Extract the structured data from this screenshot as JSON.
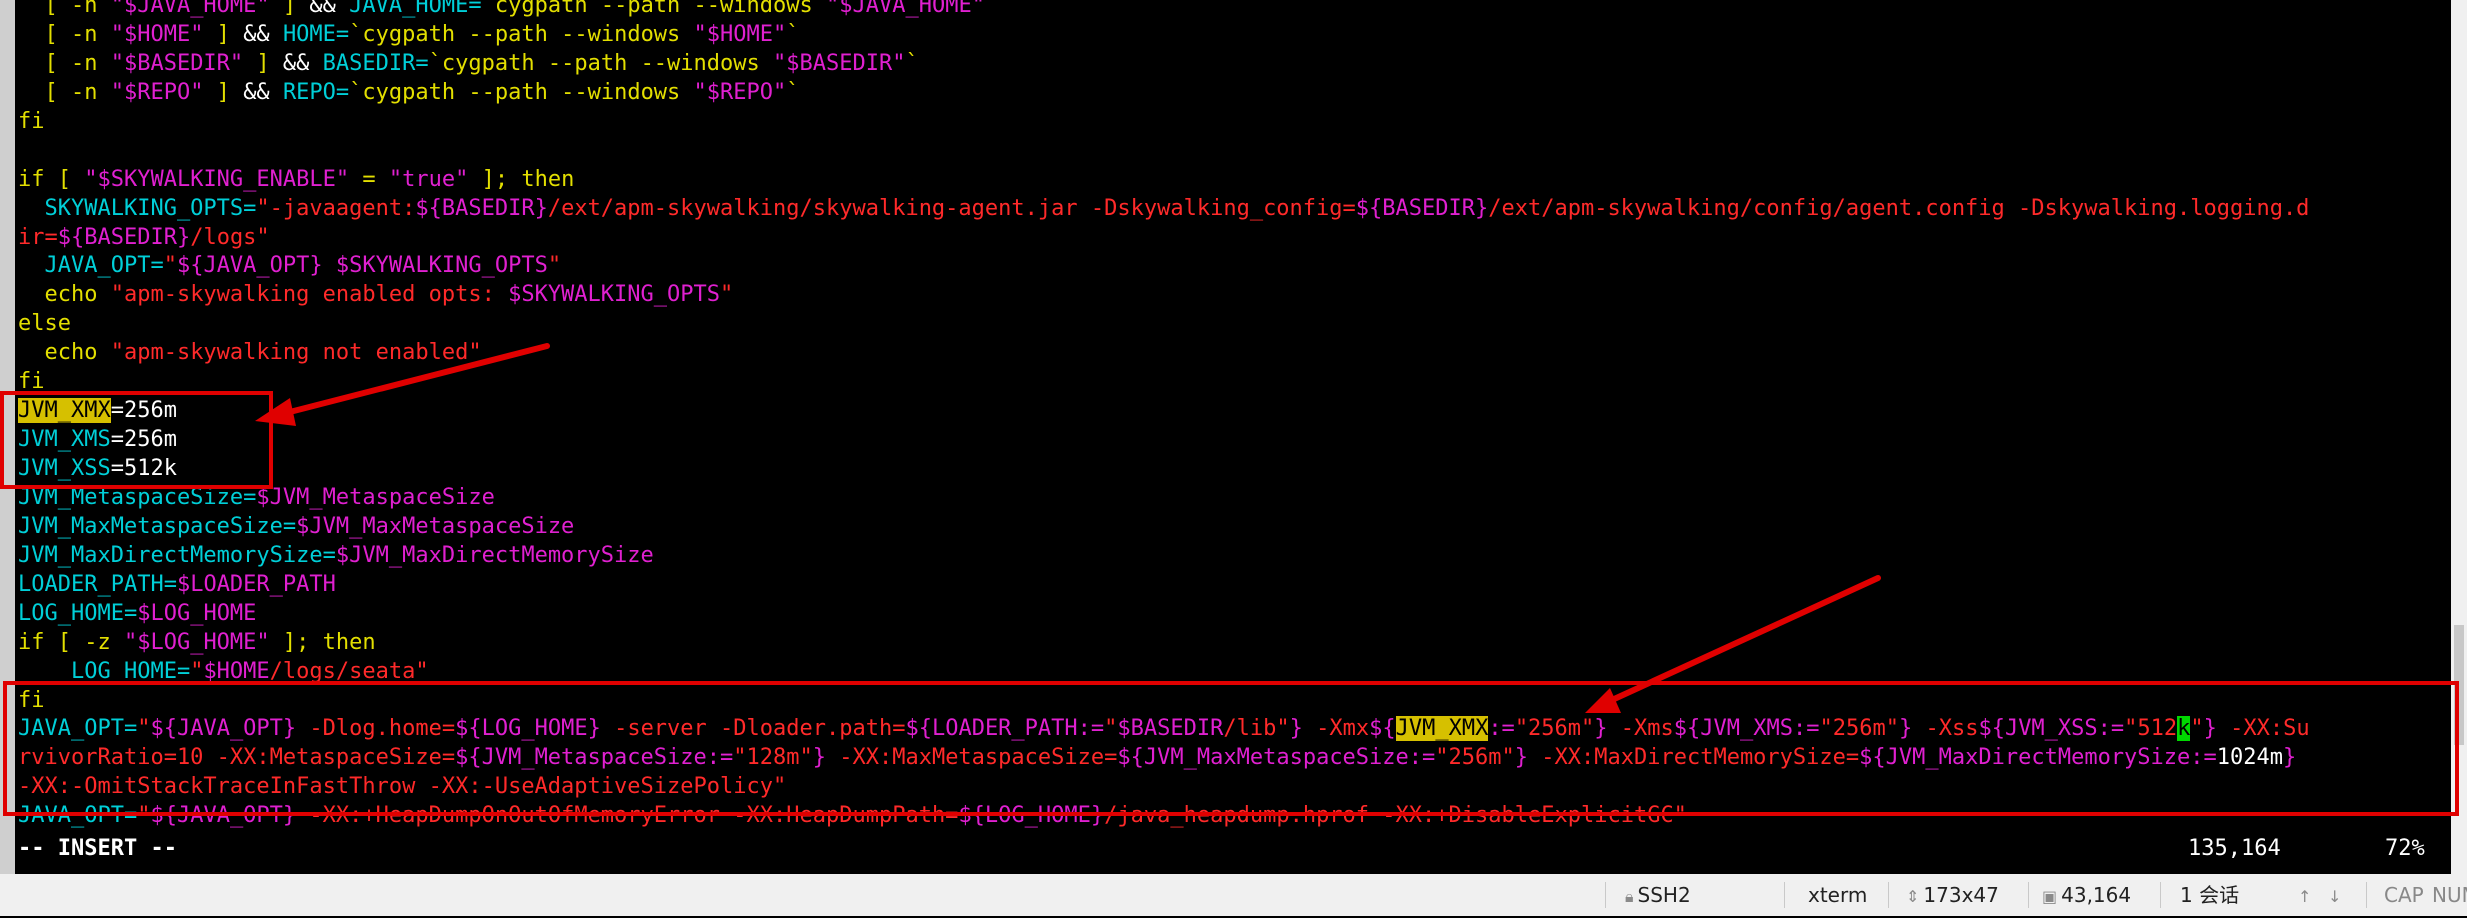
{
  "terminal": {
    "lines": [
      [
        {
          "t": "  [ -n ",
          "c": "y"
        },
        {
          "t": "\"$JAVA_HOME\"",
          "c": "m"
        },
        {
          "t": " ] ",
          "c": "y"
        },
        {
          "t": "&& ",
          "c": "w"
        },
        {
          "t": "JAVA_HOME=",
          "c": "c"
        },
        {
          "t": "`cygpath --path --windows ",
          "c": "y"
        },
        {
          "t": "\"$JAVA_HOME\"",
          "c": "m"
        },
        {
          "t": "`",
          "c": "y"
        }
      ],
      [
        {
          "t": "  [ -n ",
          "c": "y"
        },
        {
          "t": "\"$HOME\"",
          "c": "m"
        },
        {
          "t": " ] ",
          "c": "y"
        },
        {
          "t": "&& ",
          "c": "w"
        },
        {
          "t": "HOME=",
          "c": "c"
        },
        {
          "t": "`cygpath --path --windows ",
          "c": "y"
        },
        {
          "t": "\"$HOME\"",
          "c": "m"
        },
        {
          "t": "`",
          "c": "y"
        }
      ],
      [
        {
          "t": "  [ -n ",
          "c": "y"
        },
        {
          "t": "\"$BASEDIR\"",
          "c": "m"
        },
        {
          "t": " ] ",
          "c": "y"
        },
        {
          "t": "&& ",
          "c": "w"
        },
        {
          "t": "BASEDIR=",
          "c": "c"
        },
        {
          "t": "`cygpath --path --windows ",
          "c": "y"
        },
        {
          "t": "\"$BASEDIR\"",
          "c": "m"
        },
        {
          "t": "`",
          "c": "y"
        }
      ],
      [
        {
          "t": "  [ -n ",
          "c": "y"
        },
        {
          "t": "\"$REPO\"",
          "c": "m"
        },
        {
          "t": " ] ",
          "c": "y"
        },
        {
          "t": "&& ",
          "c": "w"
        },
        {
          "t": "REPO=",
          "c": "c"
        },
        {
          "t": "`cygpath --path --windows ",
          "c": "y"
        },
        {
          "t": "\"$REPO\"",
          "c": "m"
        },
        {
          "t": "`",
          "c": "y"
        }
      ],
      [
        {
          "t": "fi",
          "c": "y"
        }
      ],
      [
        {
          "t": "",
          "c": "w"
        }
      ],
      [
        {
          "t": "if [ ",
          "c": "y"
        },
        {
          "t": "\"$SKYWALKING_ENABLE\"",
          "c": "m"
        },
        {
          "t": " = ",
          "c": "y"
        },
        {
          "t": "\"true\"",
          "c": "m"
        },
        {
          "t": " ]; then",
          "c": "y"
        }
      ],
      [
        {
          "t": "  SKYWALKING_OPTS=",
          "c": "c"
        },
        {
          "t": "\"-javaagent:",
          "c": "r"
        },
        {
          "t": "${BASEDIR}",
          "c": "m"
        },
        {
          "t": "/ext/apm-skywalking/skywalking-agent.jar -Dskywalking_config=",
          "c": "r"
        },
        {
          "t": "${BASEDIR}",
          "c": "m"
        },
        {
          "t": "/ext/apm-skywalking/config/agent.config -Dskywalking.logging.d",
          "c": "r"
        }
      ],
      [
        {
          "t": "ir=",
          "c": "r"
        },
        {
          "t": "${BASEDIR}",
          "c": "m"
        },
        {
          "t": "/logs\"",
          "c": "r"
        }
      ],
      [
        {
          "t": "  JAVA_OPT=",
          "c": "c"
        },
        {
          "t": "\"",
          "c": "r"
        },
        {
          "t": "${JAVA_OPT}",
          "c": "m"
        },
        {
          "t": " ",
          "c": "r"
        },
        {
          "t": "$SKYWALKING_OPTS",
          "c": "m"
        },
        {
          "t": "\"",
          "c": "r"
        }
      ],
      [
        {
          "t": "  echo ",
          "c": "y"
        },
        {
          "t": "\"apm-skywalking enabled opts: ",
          "c": "r"
        },
        {
          "t": "$SKYWALKING_OPTS",
          "c": "m"
        },
        {
          "t": "\"",
          "c": "r"
        }
      ],
      [
        {
          "t": "else",
          "c": "y"
        }
      ],
      [
        {
          "t": "  echo ",
          "c": "y"
        },
        {
          "t": "\"apm-skywalking not enabled\"",
          "c": "r"
        }
      ],
      [
        {
          "t": "fi",
          "c": "y"
        }
      ],
      [
        {
          "t": "JVM_XMX",
          "c": "hl"
        },
        {
          "t": "=256m",
          "c": "w"
        }
      ],
      [
        {
          "t": "JVM_XMS",
          "c": "c"
        },
        {
          "t": "=256m",
          "c": "w"
        }
      ],
      [
        {
          "t": "JVM_XSS",
          "c": "c"
        },
        {
          "t": "=512k",
          "c": "w"
        }
      ],
      [
        {
          "t": "JVM_MetaspaceSize=",
          "c": "c"
        },
        {
          "t": "$JVM_MetaspaceSize",
          "c": "m"
        }
      ],
      [
        {
          "t": "JVM_MaxMetaspaceSize=",
          "c": "c"
        },
        {
          "t": "$JVM_MaxMetaspaceSize",
          "c": "m"
        }
      ],
      [
        {
          "t": "JVM_MaxDirectMemorySize=",
          "c": "c"
        },
        {
          "t": "$JVM_MaxDirectMemorySize",
          "c": "m"
        }
      ],
      [
        {
          "t": "LOADER_PATH=",
          "c": "c"
        },
        {
          "t": "$LOADER_PATH",
          "c": "m"
        }
      ],
      [
        {
          "t": "LOG_HOME=",
          "c": "c"
        },
        {
          "t": "$LOG_HOME",
          "c": "m"
        }
      ],
      [
        {
          "t": "if [ -z ",
          "c": "y"
        },
        {
          "t": "\"$LOG_HOME\"",
          "c": "m"
        },
        {
          "t": " ]; then",
          "c": "y"
        }
      ],
      [
        {
          "t": "    LOG_HOME=",
          "c": "c"
        },
        {
          "t": "\"",
          "c": "r"
        },
        {
          "t": "$HOME",
          "c": "m"
        },
        {
          "t": "/logs/seata\"",
          "c": "r"
        }
      ],
      [
        {
          "t": "fi",
          "c": "y"
        }
      ],
      [
        {
          "t": "JAVA_OPT=",
          "c": "c"
        },
        {
          "t": "\"",
          "c": "r"
        },
        {
          "t": "${JAVA_OPT}",
          "c": "m"
        },
        {
          "t": " -Dlog.home=",
          "c": "r"
        },
        {
          "t": "${LOG_HOME}",
          "c": "m"
        },
        {
          "t": " -server -Dloader.path=",
          "c": "r"
        },
        {
          "t": "${LOADER_PATH:=",
          "c": "m"
        },
        {
          "t": "\"",
          "c": "r"
        },
        {
          "t": "$BASEDIR",
          "c": "m"
        },
        {
          "t": "/lib\"",
          "c": "r"
        },
        {
          "t": "}",
          "c": "m"
        },
        {
          "t": " -Xmx",
          "c": "r"
        },
        {
          "t": "${",
          "c": "m"
        },
        {
          "t": "JVM_XMX",
          "c": "hl"
        },
        {
          "t": ":=",
          "c": "m"
        },
        {
          "t": "\"256m\"",
          "c": "r"
        },
        {
          "t": "}",
          "c": "m"
        },
        {
          "t": " -Xms",
          "c": "r"
        },
        {
          "t": "${JVM_XMS:=",
          "c": "m"
        },
        {
          "t": "\"256m\"",
          "c": "r"
        },
        {
          "t": "}",
          "c": "m"
        },
        {
          "t": " -Xss",
          "c": "r"
        },
        {
          "t": "${JVM_XSS:=",
          "c": "m"
        },
        {
          "t": "\"512",
          "c": "r"
        },
        {
          "t": "k",
          "c": "gc"
        },
        {
          "t": "\"",
          "c": "r"
        },
        {
          "t": "}",
          "c": "m"
        },
        {
          "t": " -XX:Su",
          "c": "r"
        }
      ],
      [
        {
          "t": "rvivorRatio=10 -XX:MetaspaceSize=",
          "c": "r"
        },
        {
          "t": "${JVM_MetaspaceSize:=",
          "c": "m"
        },
        {
          "t": "\"128m\"",
          "c": "r"
        },
        {
          "t": "}",
          "c": "m"
        },
        {
          "t": " -XX:MaxMetaspaceSize=",
          "c": "r"
        },
        {
          "t": "${JVM_MaxMetaspaceSize:=",
          "c": "m"
        },
        {
          "t": "\"256m\"",
          "c": "r"
        },
        {
          "t": "}",
          "c": "m"
        },
        {
          "t": " -XX:MaxDirectMemorySize=",
          "c": "r"
        },
        {
          "t": "${JVM_MaxDirectMemorySize:=",
          "c": "m"
        },
        {
          "t": "1024m",
          "c": "w"
        },
        {
          "t": "}",
          "c": "m"
        }
      ],
      [
        {
          "t": "-XX:-OmitStackTraceInFastThrow -XX:-UseAdaptiveSizePolicy\"",
          "c": "r"
        }
      ],
      [
        {
          "t": "JAVA_OPT=",
          "c": "c"
        },
        {
          "t": "\"",
          "c": "r"
        },
        {
          "t": "${JAVA_OPT}",
          "c": "m"
        },
        {
          "t": " -XX:+HeapDumpOnOutOfMemoryError -XX:HeapDumpPath=",
          "c": "r"
        },
        {
          "t": "${LOG_HOME}",
          "c": "m"
        },
        {
          "t": "/java_heapdump.hprof -XX:+DisableExplicitGC\"",
          "c": "r"
        }
      ]
    ],
    "mode_line": "-- INSERT --",
    "cursor_pos": "135,164",
    "scroll_percent": "72%"
  },
  "statusbar": {
    "protocol": "SSH2",
    "terminal_type": "xterm",
    "size": "173x47",
    "cursor": "43,164",
    "sessions": "1 会话",
    "cap": "CAP",
    "num": "NUM"
  },
  "icons": {
    "protocol": "lock-icon",
    "size": "resize-icon",
    "cursor": "cursor-position-icon",
    "scroll_up": "arrow-up-icon",
    "scroll_down": "arrow-down-icon"
  },
  "colors": {
    "background": "#000000",
    "keyword": "#e3df00",
    "variable": "#00cfd8",
    "expansion": "#e020d0",
    "string": "#ff2a2a",
    "highlight": "#d6c000",
    "cursor": "#00d800",
    "annotation": "#e00000"
  }
}
